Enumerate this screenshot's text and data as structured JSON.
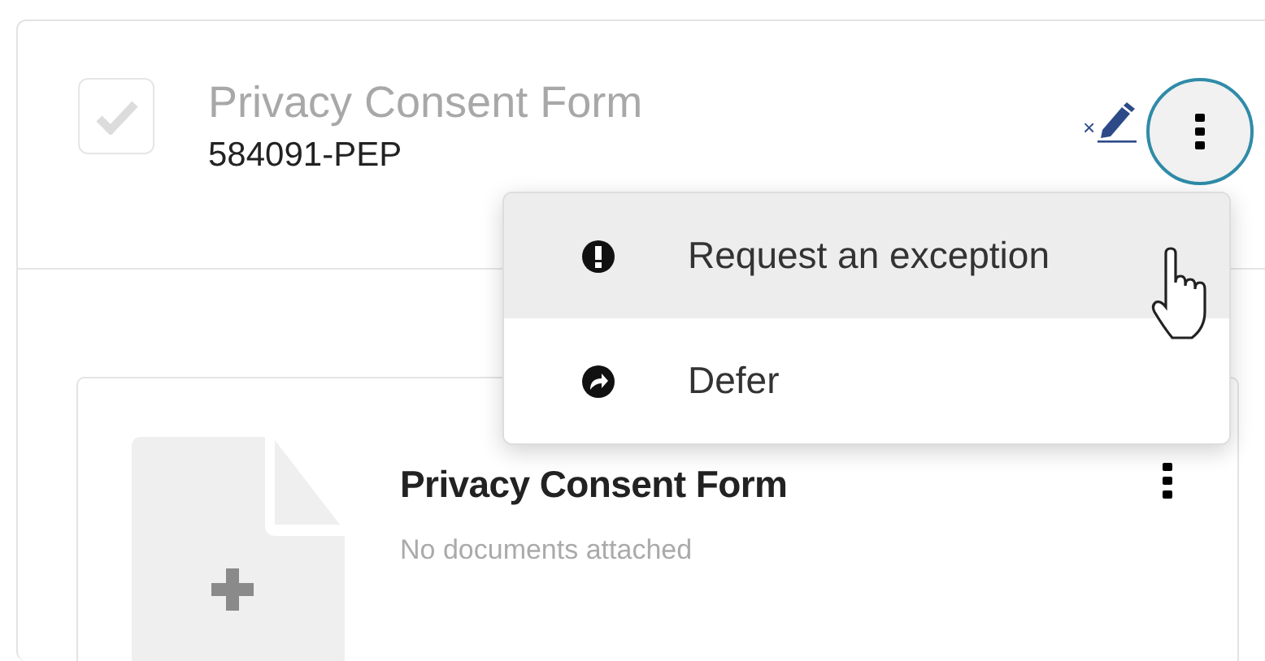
{
  "task": {
    "checked": true,
    "title": "Privacy Consent Form",
    "code": "584091-PEP",
    "edit_mark": "×",
    "menu_expanded": true
  },
  "menu": [
    {
      "kind": "exception",
      "label": "Request an exception",
      "highlighted": true
    },
    {
      "kind": "defer",
      "label": "Defer",
      "highlighted": false
    }
  ],
  "document": {
    "title": "Privacy Consent Form",
    "status": "No documents attached"
  }
}
